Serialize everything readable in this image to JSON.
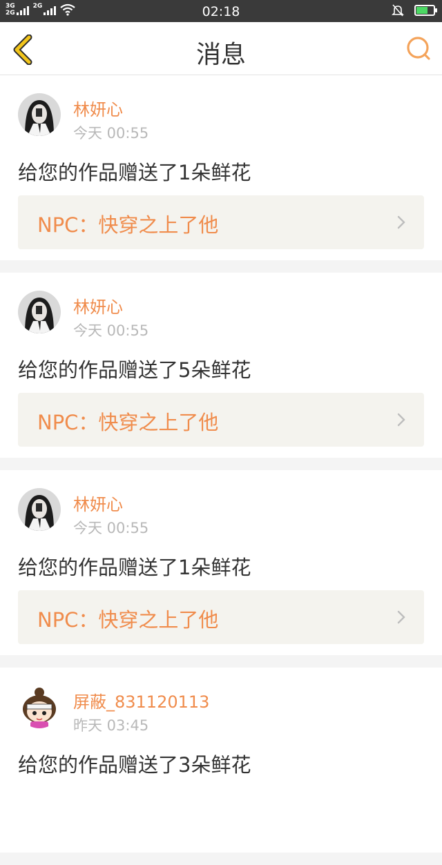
{
  "status_bar": {
    "network_1": "3G",
    "network_2": "2G",
    "network_3": "2G",
    "time": "02:18",
    "icons": [
      "signal-icon",
      "signal-icon",
      "wifi-icon",
      "silent-bell-icon",
      "battery-charging-icon"
    ]
  },
  "header": {
    "title": "消息",
    "back_icon": "chevron-left-icon",
    "search_icon": "search-icon",
    "accent_color": "#f4a35a",
    "back_color": "#f2c51b"
  },
  "messages": [
    {
      "user": "林妍心",
      "time": "今天 00:55",
      "text": "给您的作品赠送了1朵鲜花",
      "work": "NPC：快穿之上了他",
      "avatar": "girl-bw-photo"
    },
    {
      "user": "林妍心",
      "time": "今天 00:55",
      "text": "给您的作品赠送了5朵鲜花",
      "work": "NPC：快穿之上了他",
      "avatar": "girl-bw-photo"
    },
    {
      "user": "林妍心",
      "time": "今天 00:55",
      "text": "给您的作品赠送了1朵鲜花",
      "work": "NPC：快穿之上了他",
      "avatar": "girl-bw-photo"
    },
    {
      "user": "屏蔽_831120113",
      "time": "昨天 03:45",
      "text": "给您的作品赠送了3朵鲜花",
      "avatar": "cartoon-girl"
    }
  ],
  "colors": {
    "name": "#f08c4c",
    "time": "#b8b8b8",
    "text": "#333333",
    "work_bg": "#f4f3ee"
  }
}
